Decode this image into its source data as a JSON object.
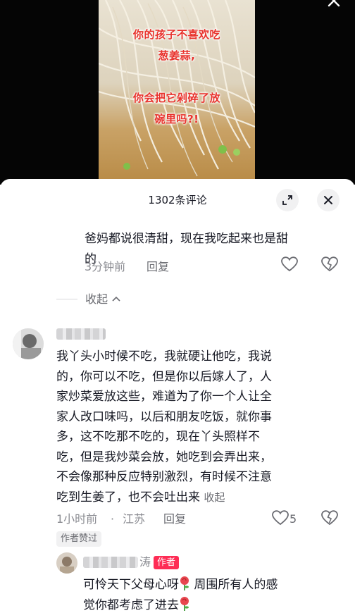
{
  "video": {
    "caption_lines": [
      "你的孩子不喜欢吃",
      "葱姜蒜,",
      "你会把它剁碎了放",
      "碗里吗?!"
    ]
  },
  "sheet": {
    "title": "1302条评论"
  },
  "reply_prev": {
    "text_line1": "爸妈都说很清甜，现在我吃起来也是甜",
    "text_line2": "的",
    "time": "3分钟前",
    "reply_label": "回复",
    "collapse_label": "收起"
  },
  "comment": {
    "lines": [
      "我丫头小时候不吃，我就硬让他吃，我说",
      "的，你可以不吃，但是你以后嫁人了，人",
      "家炒菜爱放这些，难道为了你一个人让全",
      "家人改口味吗，以后和朋友吃饭，就你事",
      "多，这不吃那不吃的，现在丫头照样不",
      "吃，但是我炒菜会放，她吃到会弄出来，",
      "不会像那种反应特别激烈，有时候不注意",
      "吃到生姜了，也不会吐出来"
    ],
    "collapse_label": "收起",
    "time": "1小时前",
    "location": "江苏",
    "reply_label": "回复",
    "like_count": "5",
    "author_liked_label": "作者赞过"
  },
  "author_reply": {
    "name_suffix": "涛",
    "author_tag": "作者",
    "line1": "可怜天下父母心呀",
    "line1b": "周围所有人的感",
    "line2": "觉你都考虑了进去"
  },
  "colors": {
    "accent": "#fe2c55",
    "caption": "#e8322c",
    "meta_text": "#8a8b91"
  }
}
